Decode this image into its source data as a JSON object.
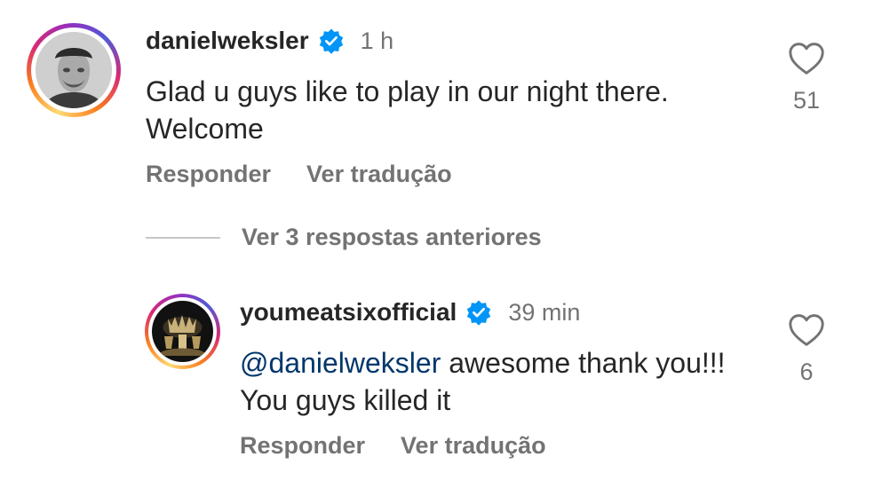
{
  "comments": [
    {
      "username": "danielweksler",
      "verified": true,
      "time": "1 h",
      "text": "Glad u guys like to play in our night there. Welcome",
      "reply_label": "Responder",
      "translate_label": "Ver tradução",
      "like_count": "51"
    },
    {
      "username": "youmeatsixofficial",
      "verified": true,
      "time": "39 min",
      "mention": "@danielweksler",
      "text": " awesome thank you!!! You guys killed it",
      "reply_label": "Responder",
      "translate_label": "Ver tradução",
      "like_count": "6"
    }
  ],
  "view_replies_label": "Ver 3 respostas anteriores",
  "colors": {
    "verified_badge": "#0095f6",
    "text": "#262626",
    "secondary": "#737373",
    "mention": "#00376b"
  },
  "icons": {
    "verified": "verified-badge-icon",
    "like": "heart-outline-icon"
  }
}
